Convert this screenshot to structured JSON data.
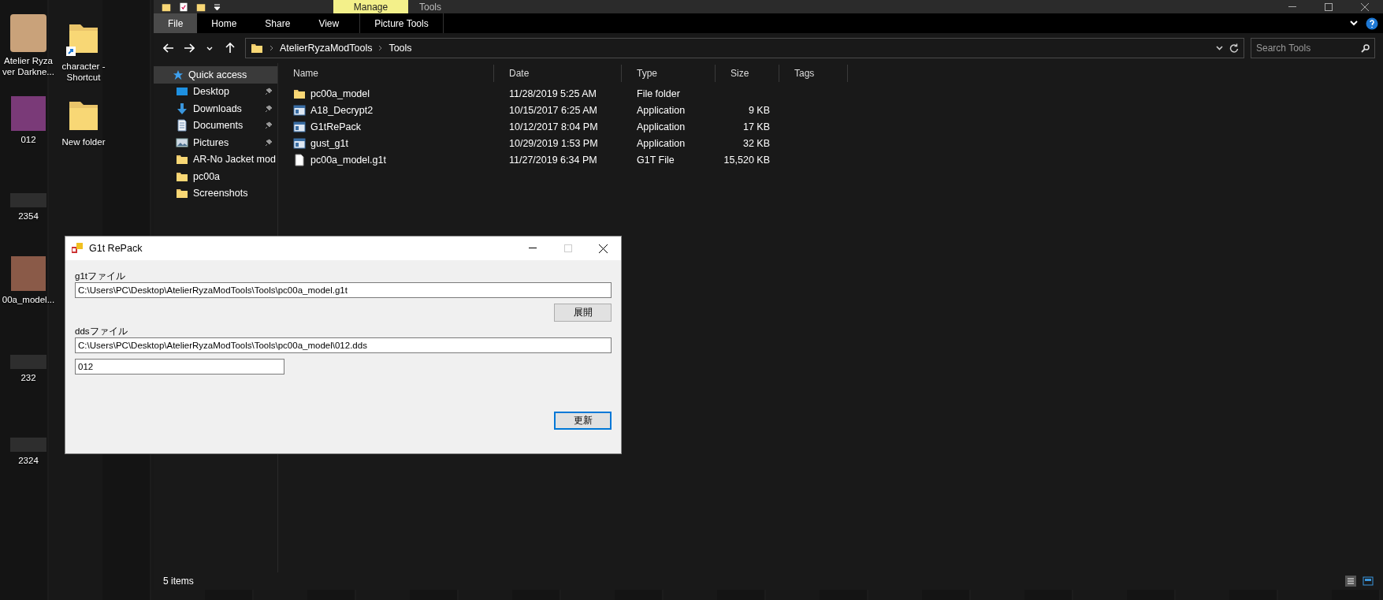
{
  "desktop_icons": [
    {
      "label": "Atelier Ryza ver Darkne...",
      "kind": "app"
    },
    {
      "label": "012",
      "kind": "image",
      "color": "#7a3a78"
    },
    {
      "label": "2354",
      "kind": "image",
      "color": "#2e2e2e"
    },
    {
      "label": "00a_model...",
      "kind": "image",
      "color": "#8a5a48"
    },
    {
      "label": "232",
      "kind": "image",
      "color": "#2e2e2e"
    },
    {
      "label": "2324",
      "kind": "image",
      "color": "#2e2e2e"
    },
    {
      "label": "character - Shortcut",
      "kind": "folder-shortcut"
    },
    {
      "label": "New folder",
      "kind": "folder"
    }
  ],
  "explorer": {
    "title": "Tools",
    "context_tab": "Manage",
    "ribbon_tabs": [
      {
        "label": "File",
        "selected": true
      },
      {
        "label": "Home",
        "selected": false
      },
      {
        "label": "Share",
        "selected": false
      },
      {
        "label": "View",
        "selected": false
      },
      {
        "label": "Picture Tools",
        "selected": false
      }
    ],
    "breadcrumb": [
      "AtelierRyzaModTools",
      "Tools"
    ],
    "search": {
      "placeholder": "Search Tools"
    },
    "sidebar": {
      "items": [
        {
          "label": "Quick access",
          "kind": "star",
          "pinned": false,
          "selected": true
        },
        {
          "label": "Desktop",
          "kind": "desktop",
          "pinned": true,
          "selected": false
        },
        {
          "label": "Downloads",
          "kind": "download",
          "pinned": true,
          "selected": false
        },
        {
          "label": "Documents",
          "kind": "document",
          "pinned": true,
          "selected": false
        },
        {
          "label": "Pictures",
          "kind": "picture",
          "pinned": true,
          "selected": false
        },
        {
          "label": "AR-No Jacket mod",
          "kind": "folder",
          "pinned": false,
          "selected": false
        },
        {
          "label": "pc00a",
          "kind": "folder",
          "pinned": false,
          "selected": false
        },
        {
          "label": "Screenshots",
          "kind": "folder",
          "pinned": false,
          "selected": false
        }
      ]
    },
    "table": {
      "columns": [
        "Name",
        "Date",
        "Type",
        "Size",
        "Tags"
      ],
      "rows": [
        {
          "kind": "folder",
          "name": "pc00a_model",
          "date": "11/28/2019 5:25 AM",
          "type": "File folder"
        },
        {
          "kind": "application",
          "name": "A18_Decrypt2",
          "date": "10/15/2017 6:25 AM",
          "type": "Application",
          "size": "9 KB"
        },
        {
          "kind": "application",
          "name": "G1tRePack",
          "date": "10/12/2017 8:04 PM",
          "type": "Application",
          "size": "17 KB"
        },
        {
          "kind": "application",
          "name": "gust_g1t",
          "date": "10/29/2019 1:53 PM",
          "type": "Application",
          "size": "32 KB"
        },
        {
          "kind": "file",
          "name": "pc00a_model.g1t",
          "date": "11/27/2019 6:34 PM",
          "type": "G1T File",
          "size": "15,520 KB"
        }
      ]
    },
    "status_bar": "5 items"
  },
  "dialog": {
    "title": "G1t RePack",
    "g1t_label": "g1tファイル",
    "g1t_path": "C:\\Users\\PC\\Desktop\\AtelierRyzaModTools\\Tools\\pc00a_model.g1t",
    "expand_button": "展開",
    "dds_label": "ddsファイル",
    "dds_path": "C:\\Users\\PC\\Desktop\\AtelierRyzaModTools\\Tools\\pc00a_model\\012.dds",
    "name_field": "012",
    "update_button": {
      "label": "更新",
      "focused": true
    }
  }
}
